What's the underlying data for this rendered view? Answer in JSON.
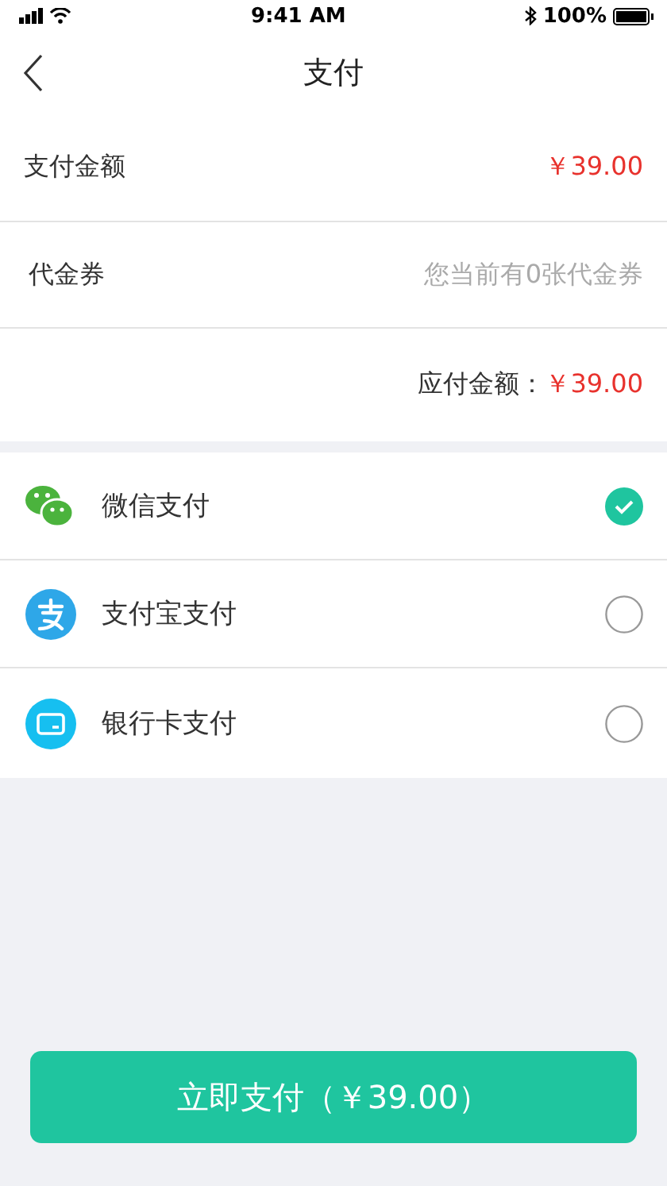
{
  "status_bar": {
    "time": "9:41 AM",
    "battery": "100%"
  },
  "nav": {
    "title": "支付"
  },
  "summary": [
    {
      "label": "支付金额",
      "value": "￥39.00",
      "kind": "amount"
    },
    {
      "label": "代金券",
      "value": "您当前有0张代金券",
      "kind": "hint"
    }
  ],
  "payable": {
    "label": "应付金额：",
    "value": "￥39.00"
  },
  "methods": [
    {
      "label": "微信支付",
      "kind": "wechat",
      "selected": true
    },
    {
      "label": "支付宝支付",
      "kind": "alipay",
      "selected": false
    },
    {
      "label": "银行卡支付",
      "kind": "card",
      "selected": false
    }
  ],
  "pay_button": "立即支付（￥39.00）"
}
